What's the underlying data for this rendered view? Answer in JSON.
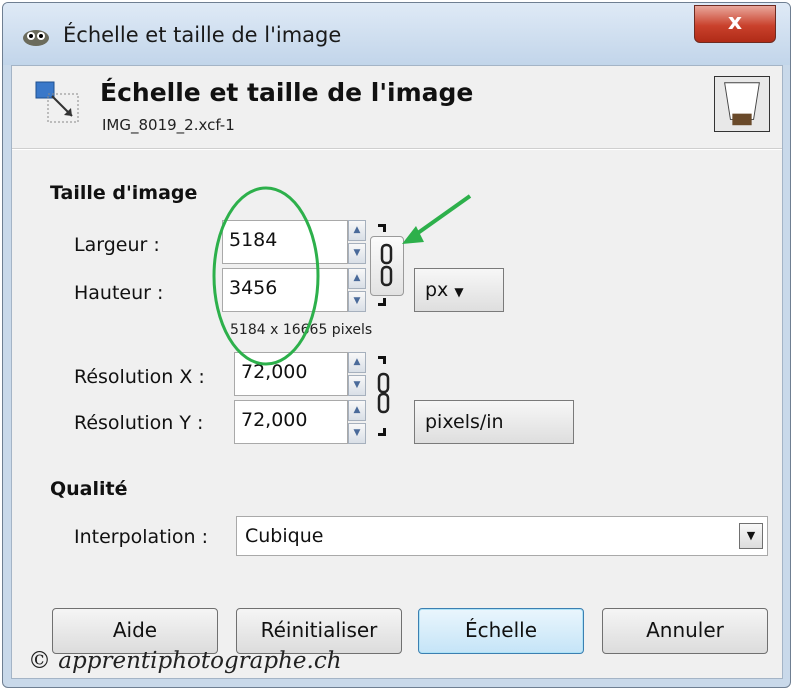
{
  "window": {
    "title": "Échelle et taille de l'image",
    "close_label": "x"
  },
  "header": {
    "title": "Échelle et taille de l'image",
    "subtitle": "IMG_8019_2.xcf-1"
  },
  "image_size": {
    "section_title": "Taille d'image",
    "width_label": "Largeur :",
    "width_value": "5184",
    "height_label": "Hauteur :",
    "height_value": "3456",
    "unit": "px",
    "size_note": "5184 x 16665 pixels",
    "res_x_label": "Résolution X :",
    "res_x_value": "72,000",
    "res_y_label": "Résolution Y :",
    "res_y_value": "72,000",
    "res_unit": "pixels/in"
  },
  "quality": {
    "section_title": "Qualité",
    "interpolation_label": "Interpolation :",
    "interpolation_value": "Cubique"
  },
  "buttons": {
    "help": "Aide",
    "reset": "Réinitialiser",
    "scale": "Échelle",
    "cancel": "Annuler"
  },
  "watermark": "© apprentiphotographe.ch",
  "colors": {
    "annotation": "#2db04b",
    "title_bar": "#c9d9ea",
    "close_button": "#c9412c"
  }
}
